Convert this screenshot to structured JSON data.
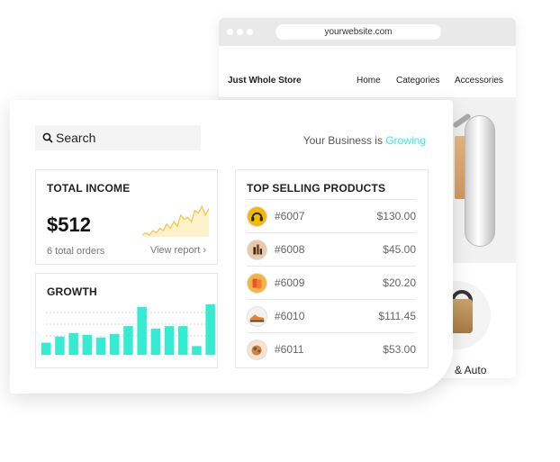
{
  "browser": {
    "url": "yourwebsite.com",
    "brand": "Just Whole Store",
    "nav": [
      "Home",
      "Categories",
      "Accessories"
    ],
    "category_label": "& Auto"
  },
  "dashboard": {
    "search_placeholder": "Search",
    "tagline_prefix": "Your Business is",
    "tagline_accent": "Growing",
    "accent_color": "#35ecd3",
    "income": {
      "title": "TOTAL INCOME",
      "value": "$512",
      "orders": "6 total orders",
      "link": "View report ›"
    },
    "growth": {
      "title": "GROWTH"
    },
    "top_selling": {
      "title": "TOP SELLING PRODUCTS",
      "products": [
        {
          "id": "#6007",
          "price": "$130.00",
          "icon": "headphones-icon"
        },
        {
          "id": "#6008",
          "price": "$45.00",
          "icon": "bottles-icon"
        },
        {
          "id": "#6009",
          "price": "$20.20",
          "icon": "cards-icon"
        },
        {
          "id": "#6010",
          "price": "$111.45",
          "icon": "shoe-icon"
        },
        {
          "id": "#6011",
          "price": "$53.00",
          "icon": "food-icon"
        }
      ]
    }
  },
  "chart_data": [
    {
      "type": "line",
      "title": "",
      "values": [
        3,
        4,
        3,
        5,
        4,
        6,
        5,
        8,
        6,
        9,
        7,
        12,
        10,
        11,
        9,
        14,
        13,
        16,
        12,
        15
      ]
    },
    {
      "type": "bar",
      "title": "",
      "values": [
        14,
        21,
        25,
        23,
        20,
        24,
        33,
        55,
        30,
        33,
        33,
        10,
        58
      ]
    }
  ]
}
